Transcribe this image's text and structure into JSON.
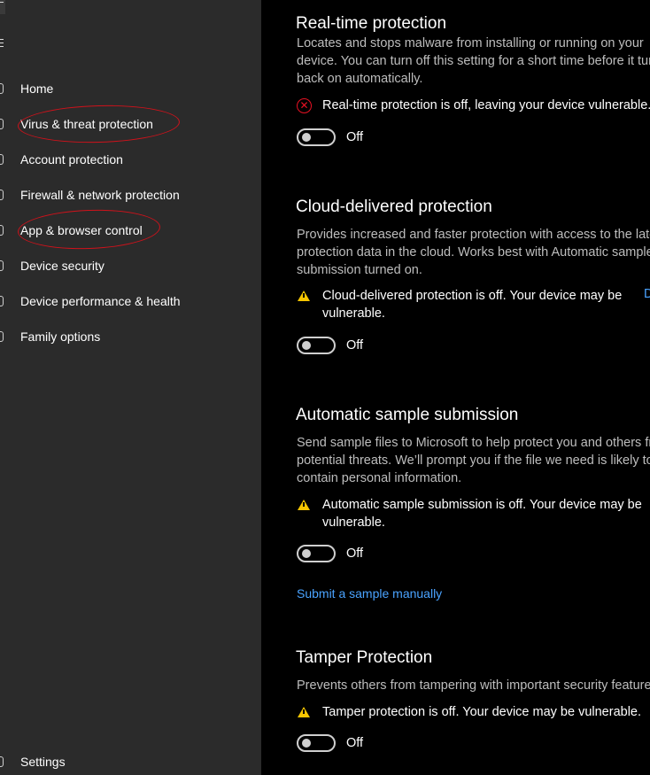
{
  "sidebar": {
    "items": [
      {
        "label": "Home"
      },
      {
        "label": "Virus & threat protection"
      },
      {
        "label": "Account protection"
      },
      {
        "label": "Firewall & network protection"
      },
      {
        "label": "App & browser control"
      },
      {
        "label": "Device security"
      },
      {
        "label": "Device performance & health"
      },
      {
        "label": "Family options"
      }
    ],
    "settings_label": "Settings"
  },
  "main": {
    "realtime": {
      "title": "Real-time protection",
      "description": "Locates and stops malware from installing or running on your device. You can turn off this setting for a short time before it turns back on automatically.",
      "status": "Real-time protection is off, leaving your device vulnerable.",
      "toggle_state": "Off"
    },
    "cloud": {
      "title": "Cloud-delivered protection",
      "description": "Provides increased and faster protection with access to the latest protection data in the cloud. Works best with Automatic sample submission turned on.",
      "status": "Cloud-delivered protection is off. Your device may be vulnerable.",
      "dismiss_link": "D",
      "toggle_state": "Off"
    },
    "sample": {
      "title": "Automatic sample submission",
      "description": "Send sample files to Microsoft to help protect you and others from potential threats. We’ll prompt you if the file we need is likely to contain personal information.",
      "status": "Automatic sample submission is off. Your device may be vulnerable.",
      "toggle_state": "Off",
      "submit_link": "Submit a sample manually"
    },
    "tamper": {
      "title": "Tamper Protection",
      "description": "Prevents others from tampering with important security features.",
      "status": "Tamper protection is off. Your device may be vulnerable.",
      "toggle_state": "Off"
    }
  },
  "colors": {
    "sidebar_bg": "#2b2b2b",
    "main_bg": "#000000",
    "link": "#4aa3ff",
    "error": "#e81123",
    "warning": "#f7c600",
    "annotation": "#d0121b"
  },
  "icons": [
    "back-icon",
    "hamburger-icon",
    "home-icon",
    "shield-icon",
    "person-icon",
    "wifi-icon",
    "browser-icon",
    "laptop-icon",
    "heart-icon",
    "family-icon",
    "gear-icon",
    "error-icon",
    "warning-icon"
  ]
}
